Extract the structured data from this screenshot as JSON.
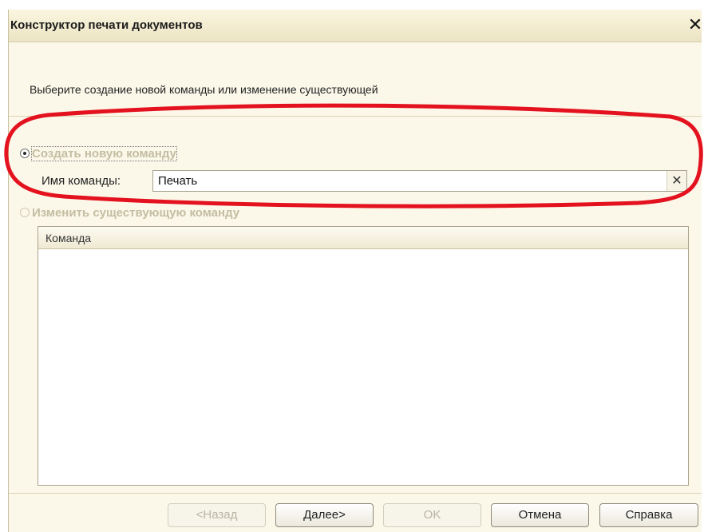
{
  "window": {
    "title": "Конструктор печати документов",
    "close_glyph": "✕"
  },
  "instruction": "Выберите создание новой команды или изменение существующей",
  "options": {
    "create_new": {
      "label": "Создать новую команду",
      "selected": true
    },
    "edit_existing": {
      "label": "Изменить существующую команду",
      "selected": false
    }
  },
  "command_name": {
    "label": "Имя команды:",
    "value": "Печать",
    "clear_glyph": "✕"
  },
  "commands_table": {
    "columns": [
      "Команда"
    ],
    "rows": []
  },
  "buttons": {
    "back": "<Назад",
    "next": "Далее>",
    "ok": "OK",
    "cancel": "Отмена",
    "help": "Справка"
  },
  "icons": {
    "close": "close-icon",
    "clear": "clear-icon"
  },
  "colors": {
    "annotation": "#e3121e",
    "window_bg": "#fbf8ea",
    "disabled_text": "#c4bda2"
  }
}
